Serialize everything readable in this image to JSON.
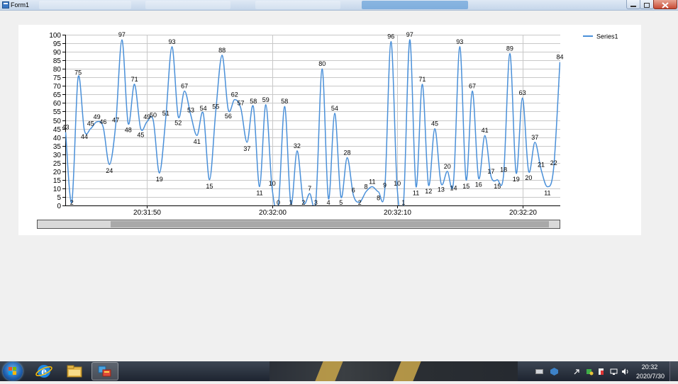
{
  "window": {
    "title": "Form1"
  },
  "taskbar": {
    "clock_time": "20:32",
    "clock_date": "2020/7/30",
    "apps": [
      "internet-explorer",
      "file-explorer",
      "form1-app"
    ]
  },
  "chart_data": {
    "type": "line",
    "smoothed": true,
    "series": [
      {
        "name": "Series1",
        "color": "#4a90d9",
        "x": [
          0,
          1,
          2,
          3,
          4,
          5,
          6,
          7,
          8,
          9,
          10,
          11,
          12,
          13,
          14,
          15,
          16,
          17,
          18,
          19,
          20,
          21,
          22,
          23,
          24,
          25,
          26,
          27,
          28,
          29,
          30,
          31,
          32,
          33,
          34,
          35,
          36,
          37,
          38,
          39,
          40,
          41,
          42,
          43,
          44,
          45,
          46,
          47,
          48,
          49,
          50,
          51,
          52,
          53,
          54,
          55,
          56,
          57,
          58,
          59,
          60,
          61,
          62,
          63,
          64,
          65,
          66,
          67,
          68,
          69,
          70,
          71,
          72,
          73,
          74,
          75,
          76,
          77,
          78,
          79
        ],
        "values": [
          43,
          2,
          75,
          44,
          45,
          49,
          46,
          24,
          47,
          97,
          48,
          71,
          45,
          49,
          50,
          19,
          51,
          93,
          52,
          67,
          53,
          41,
          54,
          15,
          55,
          88,
          56,
          62,
          57,
          37,
          58,
          11,
          59,
          10,
          0,
          58,
          1,
          32,
          2,
          7,
          3,
          80,
          4,
          54,
          5,
          28,
          6,
          2,
          8,
          11,
          8,
          9,
          96,
          10,
          1,
          97,
          11,
          71,
          12,
          45,
          13,
          20,
          14,
          93,
          15,
          67,
          16,
          41,
          17,
          15,
          18,
          89,
          19,
          63,
          20,
          37,
          21,
          11,
          22,
          84
        ]
      }
    ],
    "x_ticks": [
      {
        "index": 13,
        "label": "20:31:50"
      },
      {
        "index": 33,
        "label": "20:32:00"
      },
      {
        "index": 53,
        "label": "20:32:10"
      },
      {
        "index": 73,
        "label": "20:32:20"
      }
    ],
    "ylim": [
      0,
      100
    ],
    "y_ticks": [
      0,
      5,
      10,
      15,
      20,
      25,
      30,
      35,
      40,
      45,
      50,
      55,
      60,
      65,
      70,
      75,
      80,
      85,
      90,
      95,
      100
    ],
    "grid": true,
    "legend": {
      "position": "top-right",
      "entries": [
        "Series1"
      ]
    },
    "data_labels": true
  },
  "scrollbar": {
    "position_fraction": 0.14,
    "visible_fraction": 0.84
  }
}
